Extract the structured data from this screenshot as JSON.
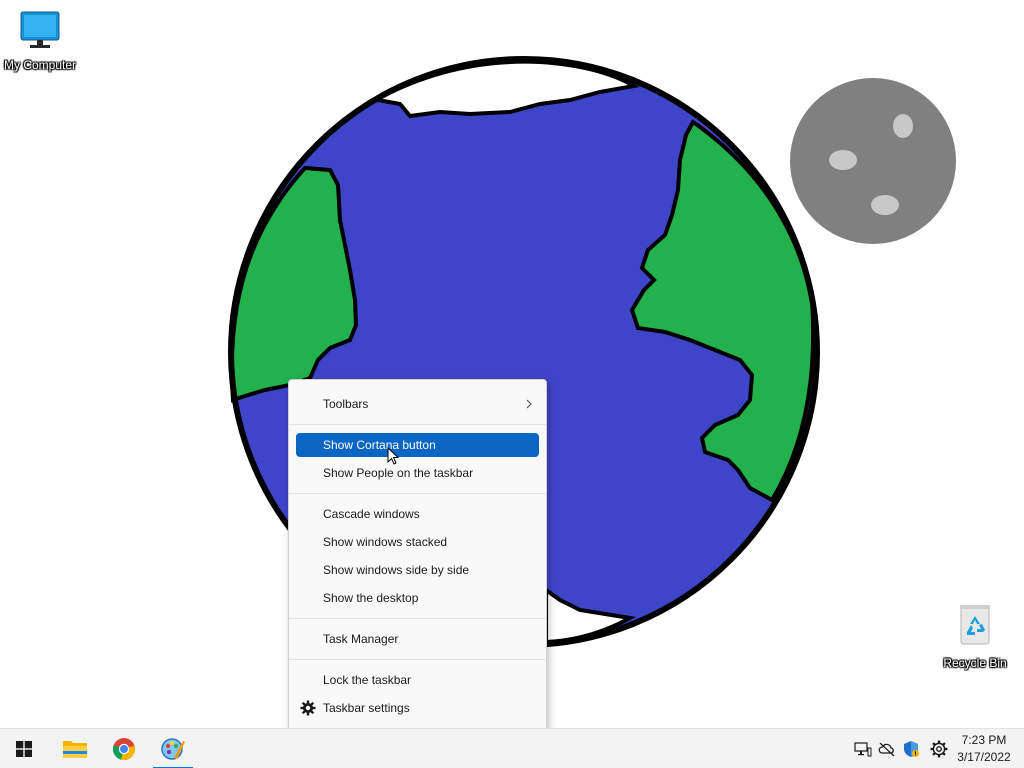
{
  "desktop": {
    "icons": [
      {
        "label": "My Computer",
        "icon": "monitor-icon"
      },
      {
        "label": "Recycle Bin",
        "icon": "recycle-bin-icon"
      }
    ],
    "wallpaper": {
      "earth_ocean": "#3f45c9",
      "earth_land": "#22b14c",
      "moon": "#808080",
      "moon_craters": "#c8c8c8"
    }
  },
  "context_menu": {
    "items": [
      {
        "label": "Toolbars",
        "submenu": true
      },
      {
        "label": "Show Cortana button",
        "highlighted": true
      },
      {
        "label": "Show People on the taskbar"
      },
      {
        "label": "Cascade windows"
      },
      {
        "label": "Show windows stacked"
      },
      {
        "label": "Show windows side by side"
      },
      {
        "label": "Show the desktop"
      },
      {
        "label": "Task Manager"
      },
      {
        "label": "Lock the taskbar"
      },
      {
        "label": "Taskbar settings",
        "icon": "gear-icon"
      }
    ]
  },
  "taskbar": {
    "pinned": [
      "start-icon",
      "file-explorer-icon",
      "chrome-icon",
      "paint-icon"
    ],
    "active_app": "paint-icon",
    "tray": [
      "network-icon",
      "onedrive-icon",
      "security-icon",
      "settings-icon"
    ],
    "clock": {
      "time": "7:23 PM",
      "date": "3/17/2022"
    }
  },
  "colors": {
    "accent": "#0a66c2",
    "taskbar_bg": "#f3f3f3"
  }
}
